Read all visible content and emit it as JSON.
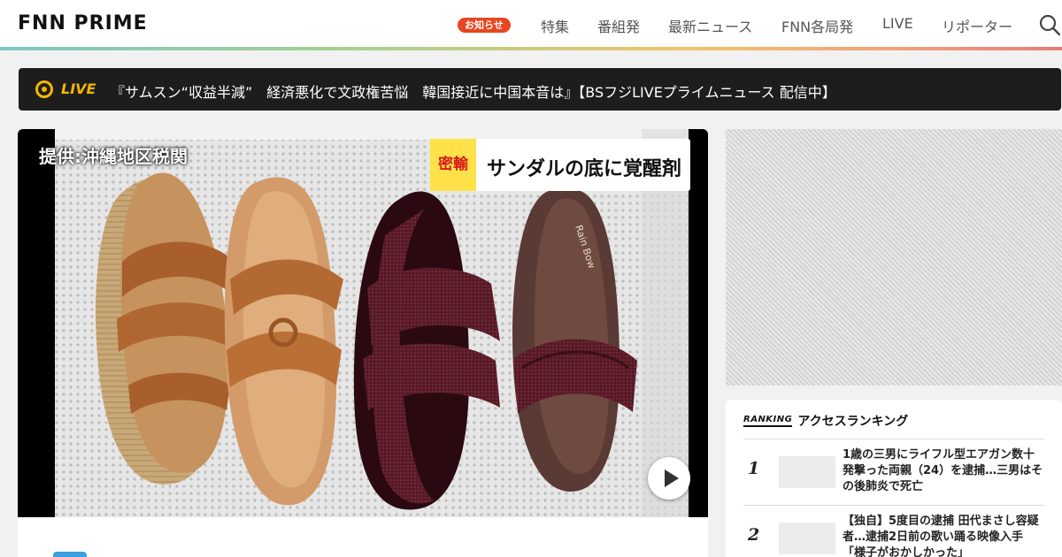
{
  "header": {
    "logo": "FNN PRIME",
    "notice_badge": "お知らせ",
    "nav": [
      "特集",
      "番組発",
      "最新ニュース",
      "FNN各局発",
      "LIVE",
      "リポーター"
    ],
    "search_icon": "search-icon"
  },
  "live": {
    "label": "LIVE",
    "text": "『サムスン“収益半減”　経済悪化で文政権苦悩　韓国接近に中国本音は』【BSフジLIVEプライムニュース 配信中】"
  },
  "video": {
    "caption_source": "提供:沖縄地区税関",
    "caption_tag": "密輸",
    "caption_title": "サンダルの底に覚醒剤",
    "shoe_brand": "Rain Bow",
    "play_icon": "play-icon"
  },
  "ranking": {
    "logo": "RANKING",
    "title": "アクセスランキング",
    "items": [
      {
        "rank": "1",
        "text": "1歳の三男にライフル型エアガン数十発撃った両親（24）を逮捕…三男はその後肺炎で死亡"
      },
      {
        "rank": "2",
        "text": "【独自】5度目の逮捕 田代まさし容疑者…逮捕2日前の歌い踊る映像入手「様子がおかしかった」"
      }
    ]
  },
  "colors": {
    "accent": "#e8461f",
    "live": "#f5b700",
    "livebar": "#1d1d1d"
  }
}
